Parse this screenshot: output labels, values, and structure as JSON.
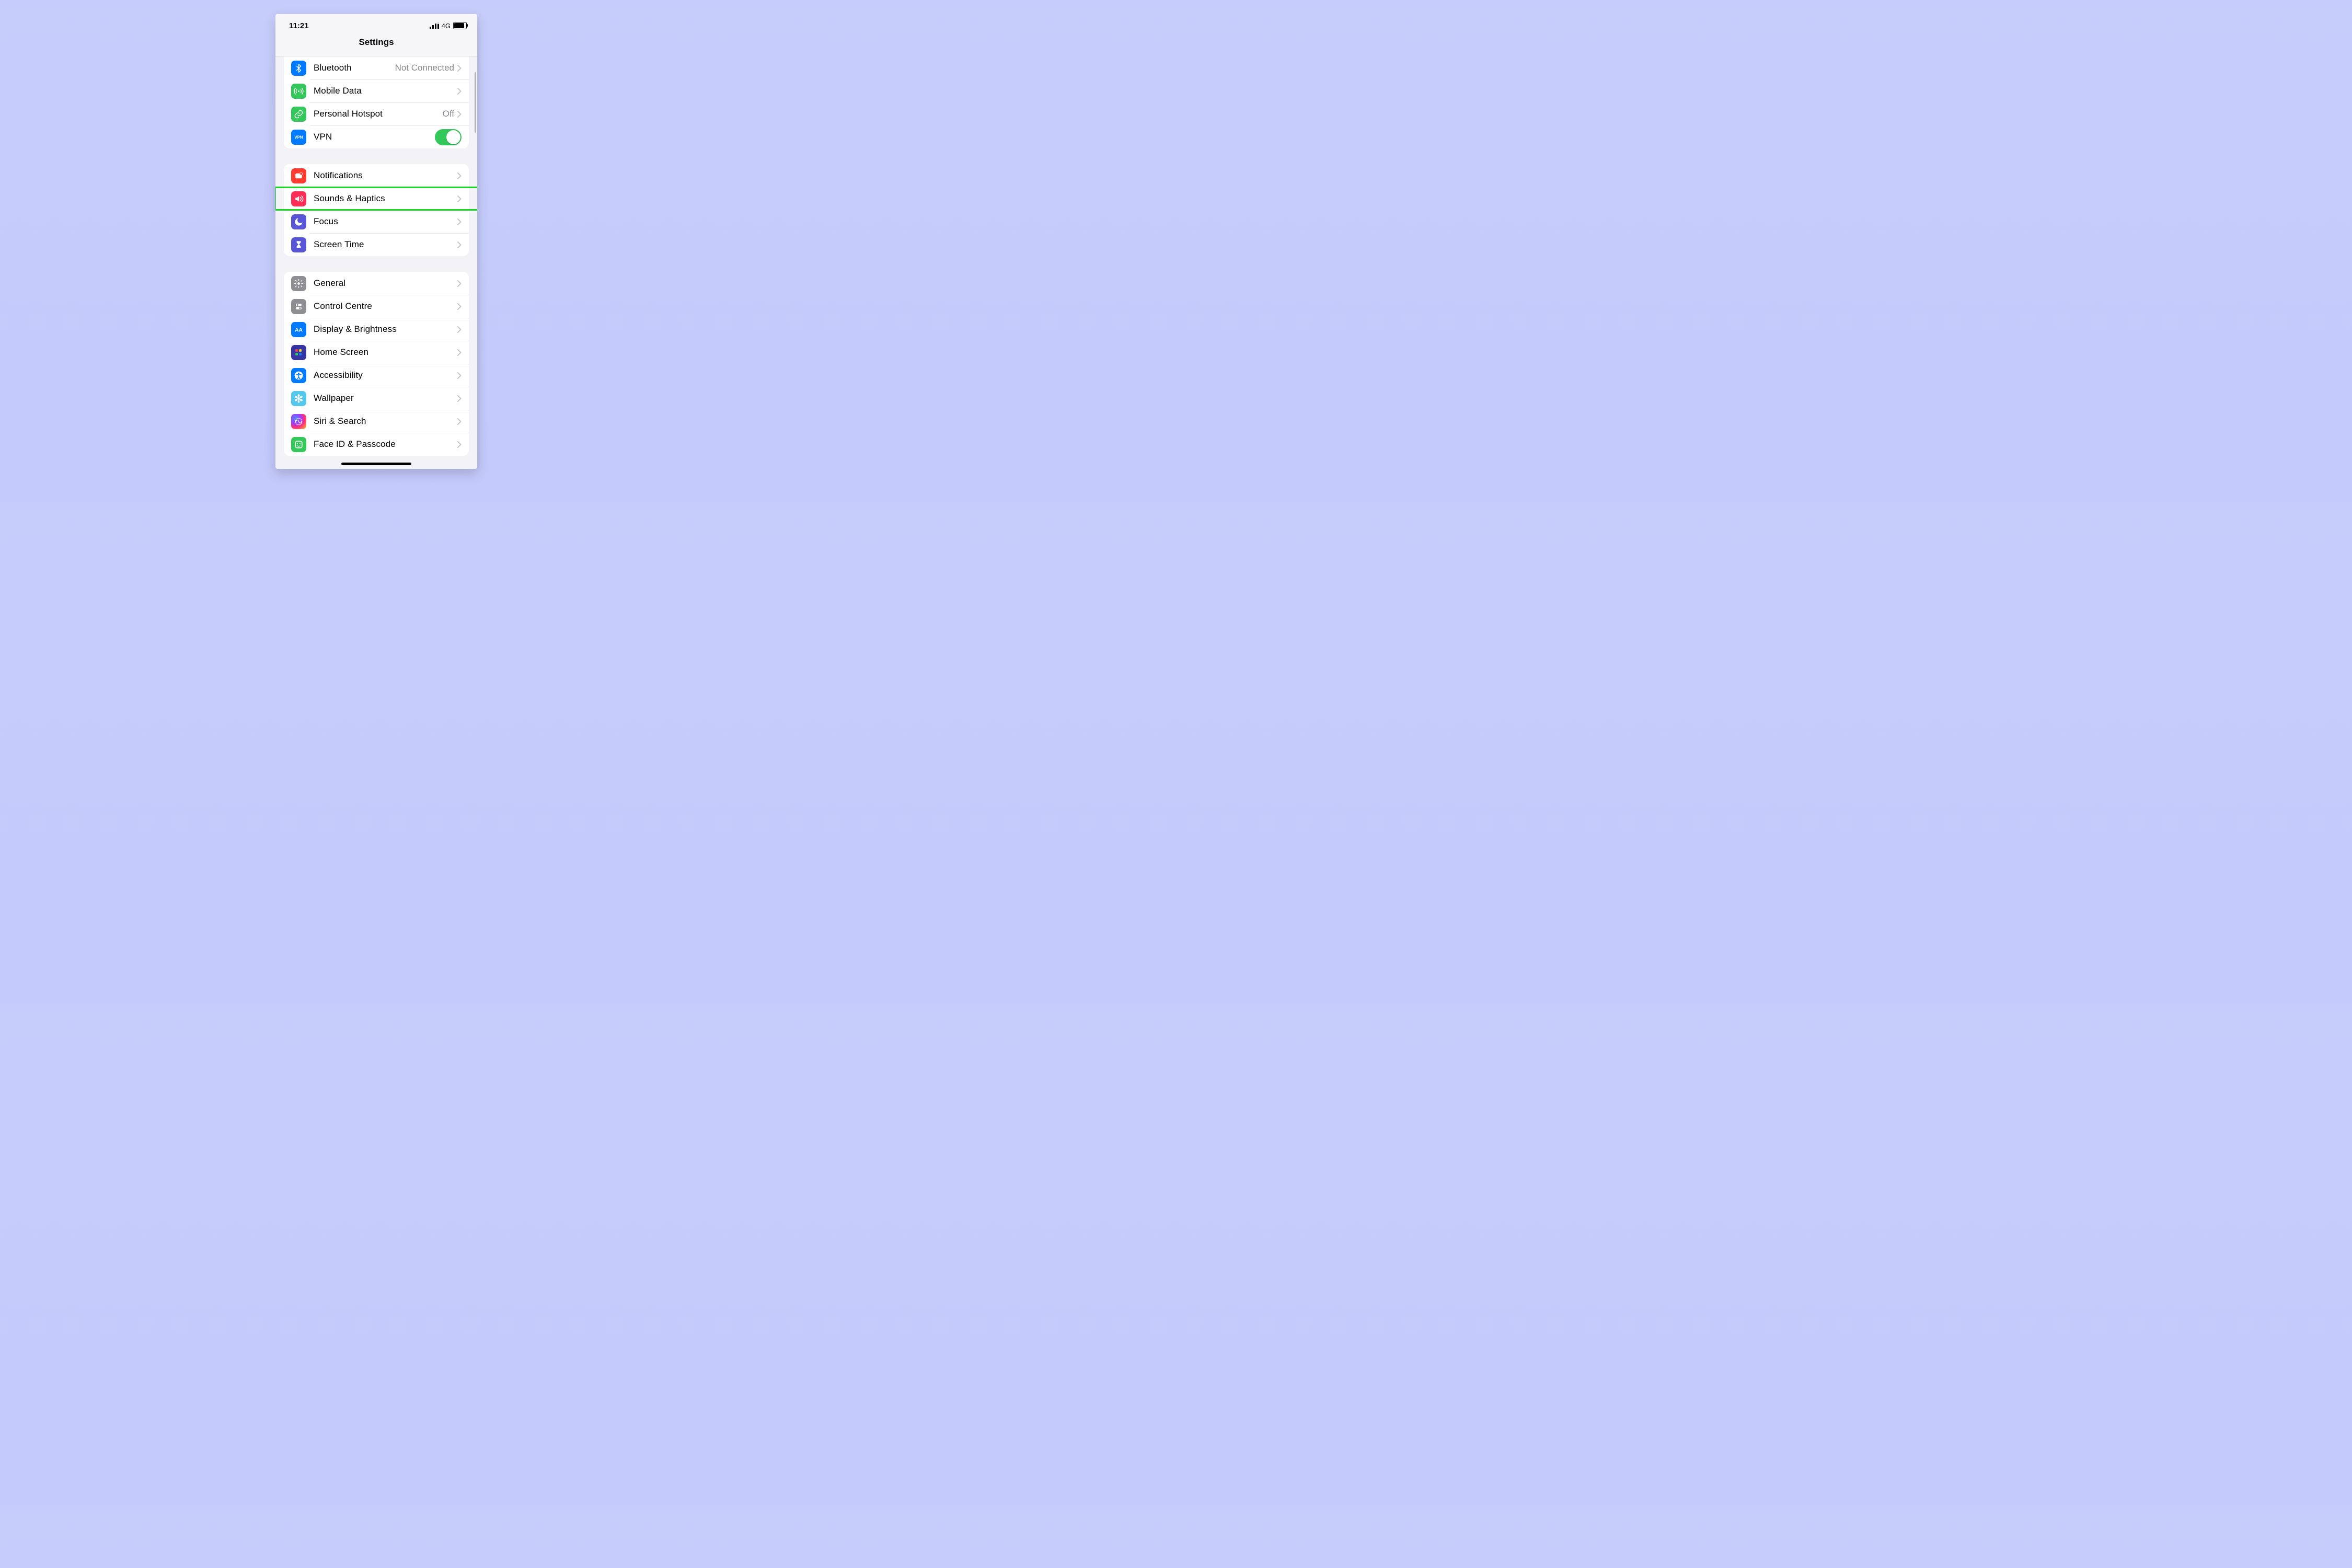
{
  "status": {
    "time": "11:21",
    "network": "4G"
  },
  "title": "Settings",
  "groups": [
    {
      "id": "connectivity",
      "rows": [
        {
          "id": "bluetooth",
          "label": "Bluetooth",
          "value": "Not Connected",
          "icon": "bluetooth",
          "bg": "#007aff",
          "chevron": true
        },
        {
          "id": "mobile-data",
          "label": "Mobile Data",
          "value": "",
          "icon": "antenna",
          "bg": "#34c759",
          "chevron": true
        },
        {
          "id": "personal-hotspot",
          "label": "Personal Hotspot",
          "value": "Off",
          "icon": "link",
          "bg": "#34c759",
          "chevron": true
        },
        {
          "id": "vpn",
          "label": "VPN",
          "value": "",
          "icon": "vpn",
          "bg": "#007aff",
          "toggle": true,
          "toggle_on": true
        }
      ]
    },
    {
      "id": "attention",
      "rows": [
        {
          "id": "notifications",
          "label": "Notifications",
          "icon": "bell",
          "bg": "#ff3b30",
          "chevron": true
        },
        {
          "id": "sounds-haptics",
          "label": "Sounds & Haptics",
          "icon": "speaker",
          "bg": "#ff2d55",
          "chevron": true,
          "highlighted": true
        },
        {
          "id": "focus",
          "label": "Focus",
          "icon": "moon",
          "bg": "#5856d6",
          "chevron": true
        },
        {
          "id": "screen-time",
          "label": "Screen Time",
          "icon": "hourglass",
          "bg": "#5856d6",
          "chevron": true
        }
      ]
    },
    {
      "id": "general",
      "rows": [
        {
          "id": "general",
          "label": "General",
          "icon": "gear",
          "bg": "#8e8e93",
          "chevron": true
        },
        {
          "id": "control-centre",
          "label": "Control Centre",
          "icon": "sliders",
          "bg": "#8e8e93",
          "chevron": true
        },
        {
          "id": "display-brightness",
          "label": "Display & Brightness",
          "icon": "aa",
          "bg": "#007aff",
          "chevron": true
        },
        {
          "id": "home-screen",
          "label": "Home Screen",
          "icon": "grid",
          "bg": "#3634a3",
          "chevron": true
        },
        {
          "id": "accessibility",
          "label": "Accessibility",
          "icon": "accessibility",
          "bg": "#007aff",
          "chevron": true
        },
        {
          "id": "wallpaper",
          "label": "Wallpaper",
          "icon": "flower",
          "bg": "#54c7ec",
          "chevron": true
        },
        {
          "id": "siri-search",
          "label": "Siri & Search",
          "icon": "siri",
          "bg": "siri",
          "chevron": true
        },
        {
          "id": "face-id-passcode",
          "label": "Face ID & Passcode",
          "icon": "face",
          "bg": "#34c759",
          "chevron": true
        }
      ]
    }
  ]
}
